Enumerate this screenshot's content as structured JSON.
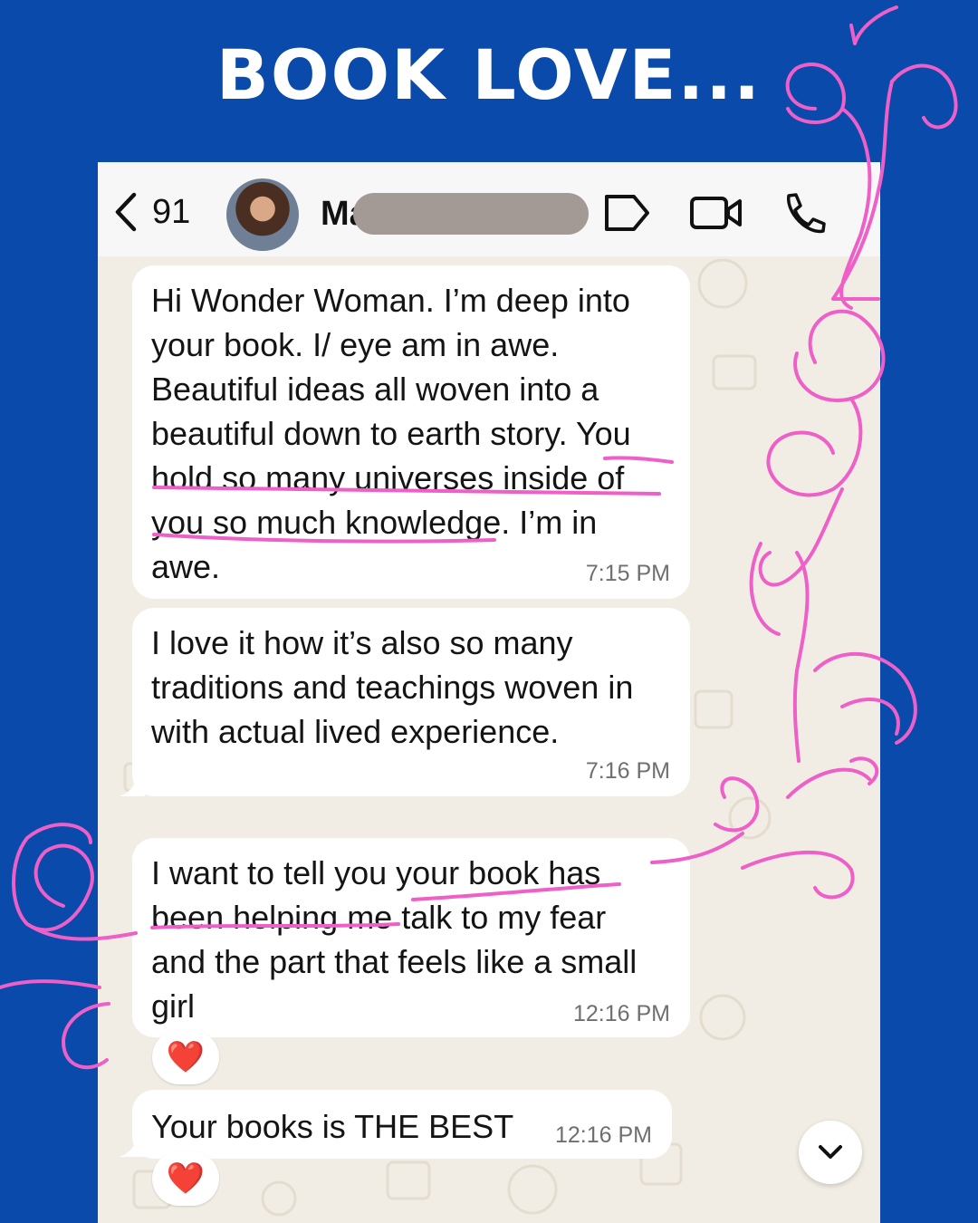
{
  "banner": {
    "title": "BOOK LOVE..."
  },
  "header": {
    "back_count": "91",
    "contact_name": "Ma",
    "icons": [
      "back-chevron-icon",
      "avatar",
      "label-tag-icon",
      "video-call-icon",
      "phone-icon"
    ]
  },
  "messages": [
    {
      "text": "Hi Wonder Woman. I’m deep into\nyour book. I/ eye am in awe.\nBeautiful ideas all woven into a\nbeautiful down to earth story. You\nhold so many universes inside of\nyou so much knowledge. I’m in\nawe.",
      "time": "7:15 PM"
    },
    {
      "text": "I love it how it’s also so many\ntraditions and teachings woven in\nwith actual lived experience.",
      "time": "7:16 PM"
    },
    {
      "text": "I want to tell you your book has\nbeen helping me talk to my fear\nand the part that feels like a small\ngirl",
      "time": "12:16 PM",
      "reaction": "❤️"
    },
    {
      "text": "Your books is THE BEST",
      "time": "12:16 PM",
      "reaction": "❤️"
    }
  ],
  "colors": {
    "background": "#0a4aab",
    "chat_background": "#f2ede4",
    "bubble": "#ffffff",
    "doodle_pink": "#ee5fc8",
    "redaction": "#a39a96"
  }
}
